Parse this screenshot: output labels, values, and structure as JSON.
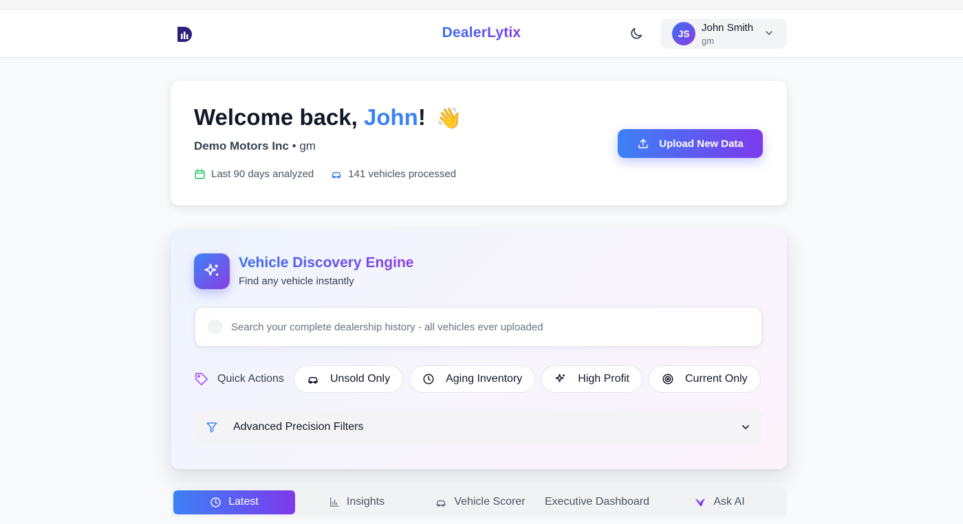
{
  "header": {
    "brand": "DealerLytix",
    "user": {
      "initials": "JS",
      "name": "John Smith",
      "role": "gm"
    }
  },
  "welcome": {
    "greeting": "Welcome back, ",
    "name": "John",
    "exclaim": "!",
    "emoji": "👋",
    "company": "Demo Motors Inc",
    "separator": " • ",
    "role": "gm",
    "meta": {
      "analyzed": "Last 90 days analyzed",
      "processed": "141 vehicles processed"
    },
    "upload_label": "Upload New Data"
  },
  "engine": {
    "title": "Vehicle Discovery Engine",
    "subtitle": "Find any vehicle instantly",
    "search_placeholder": "Search your complete dealership history - all vehicles ever uploaded",
    "search_value": "",
    "quick_actions_label": "Quick Actions",
    "chips": [
      "Unsold Only",
      "Aging Inventory",
      "High Profit",
      "Current Only"
    ],
    "filters_label": "Advanced Precision Filters"
  },
  "tabs": [
    "Latest",
    "Insights",
    "Vehicle Scorer",
    "Executive Dashboard",
    "Ask AI"
  ],
  "colors": {
    "accent_blue": "#3b82f6",
    "accent_purple": "#7c3aed",
    "calendar_green": "#22c55e",
    "tag_purple": "#a855f7"
  }
}
